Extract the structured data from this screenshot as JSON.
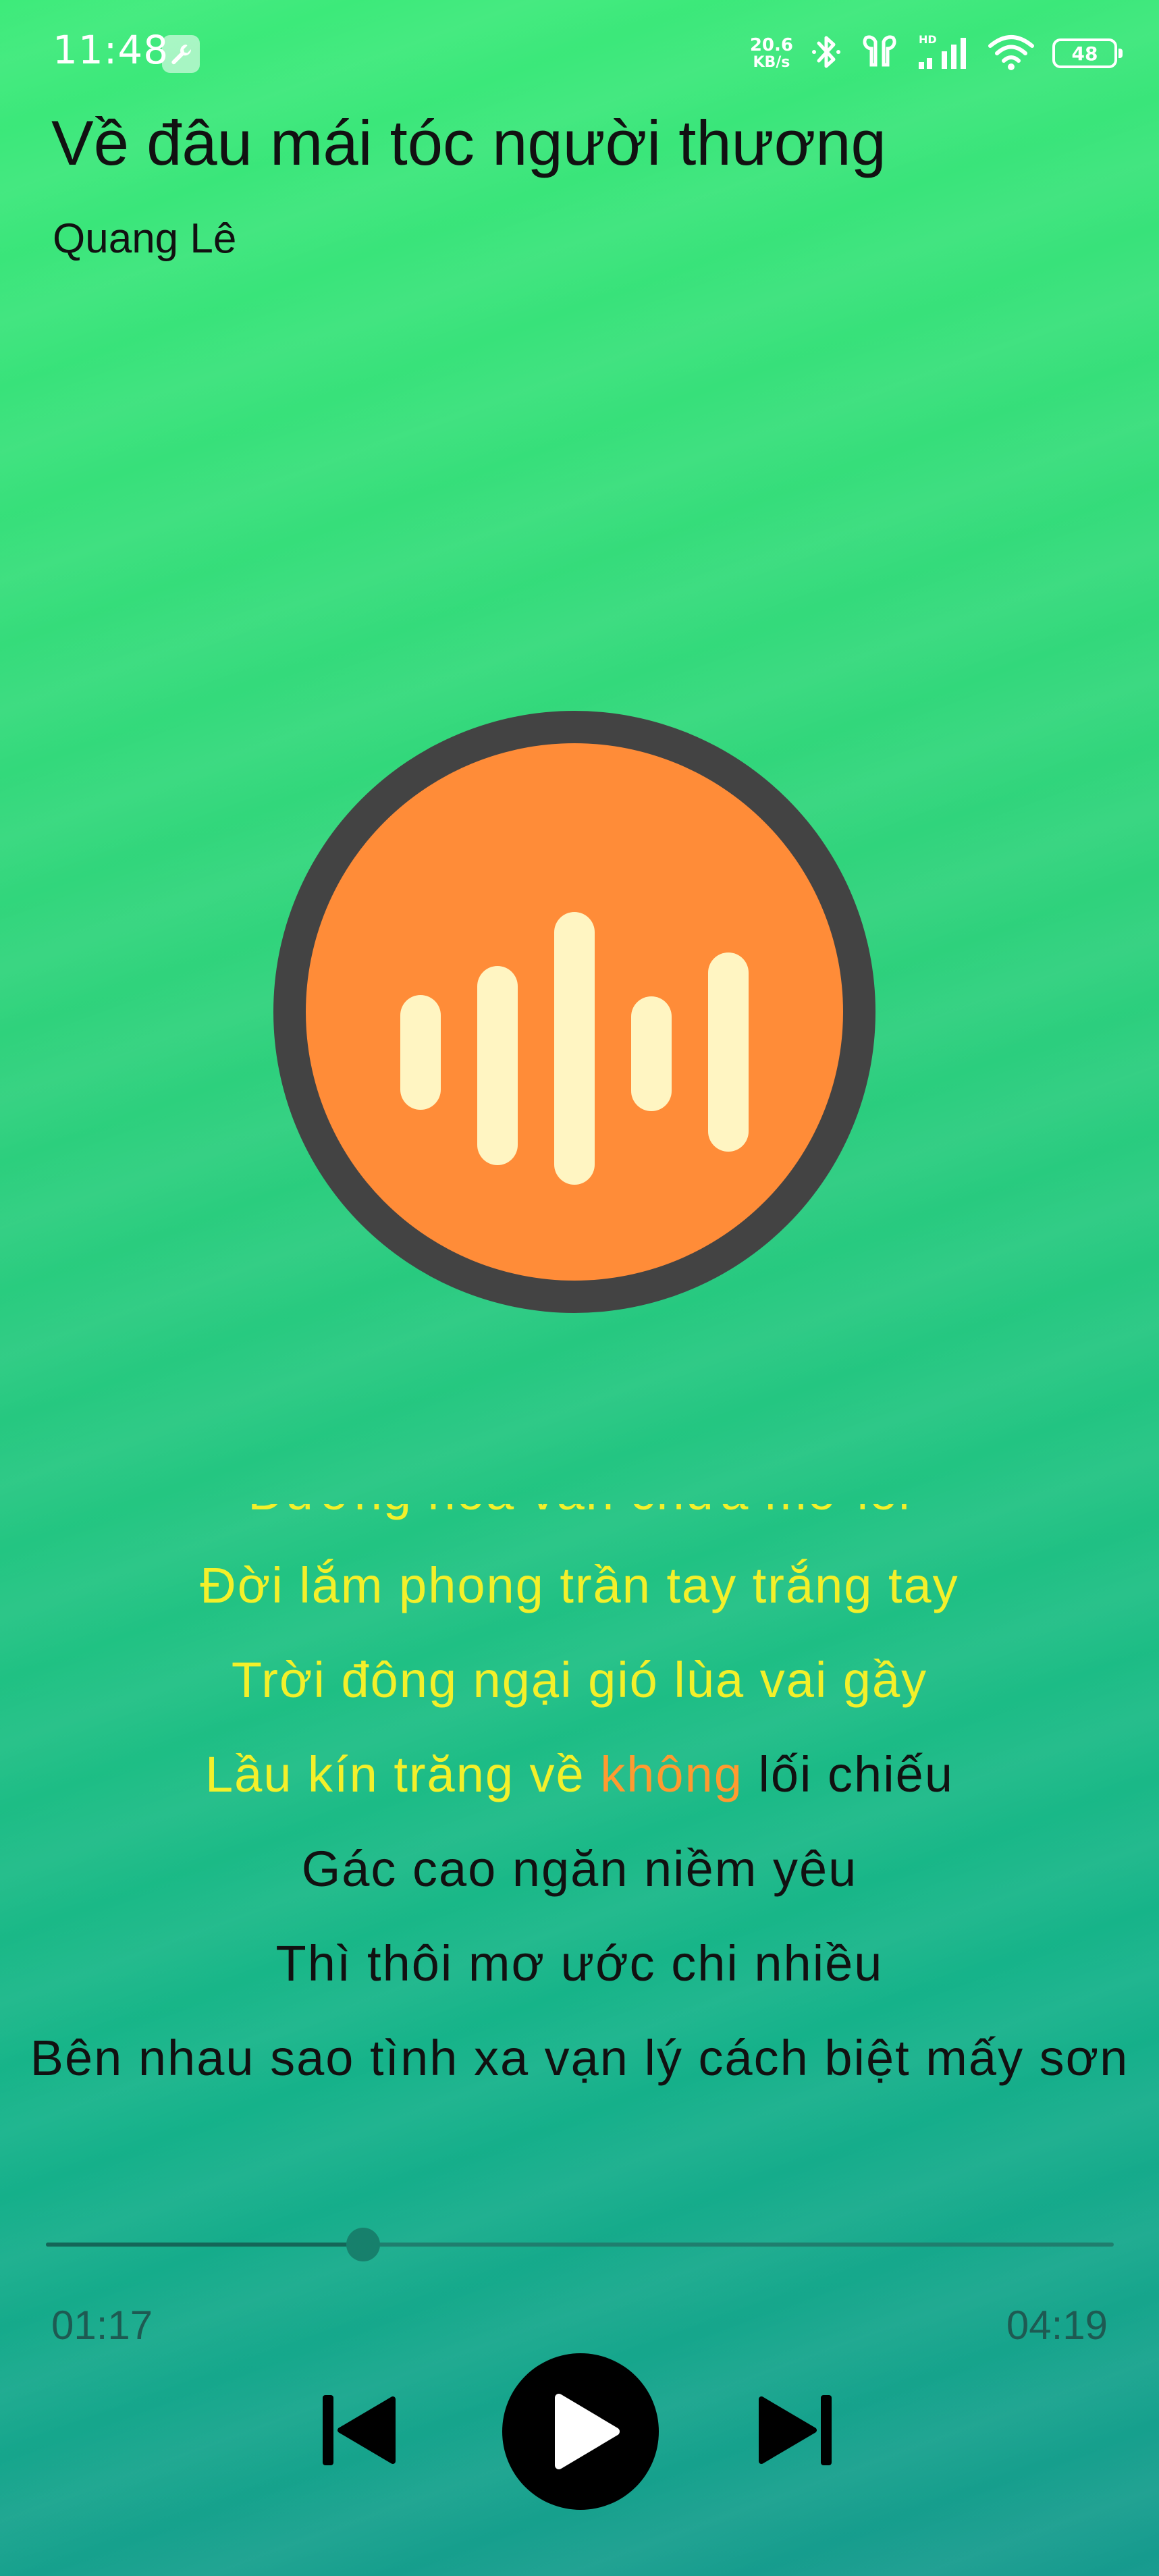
{
  "status_bar": {
    "time": "11:48",
    "net_speed_value": "20.6",
    "net_speed_unit": "KB/s",
    "battery_level": "48",
    "icons": [
      "wrench-icon",
      "bluetooth-icon",
      "earbuds-icon",
      "hd-signal-icon",
      "wifi-icon",
      "battery-icon"
    ]
  },
  "song": {
    "title": "Về đâu mái tóc người thương",
    "artist": "Quang Lê"
  },
  "album_art": {
    "icon": "audio-wave-icon",
    "ring_color": "#434343",
    "fill_color": "#ff8c38",
    "wave_color": "#fff5c2"
  },
  "lyrics": {
    "lines": [
      {
        "text": "Đường hoa vẫn chưa mở lối",
        "state": "sung"
      },
      {
        "text": "Đời lắm phong trần tay trắng tay",
        "state": "sung"
      },
      {
        "text": "Trời đông ngại gió lùa vai gầy",
        "state": "sung"
      },
      {
        "text": "Lầu kín trăng về không lối chiếu",
        "state": "current",
        "parts": {
          "before": "Lầu kín trăng về ",
          "highlight": "không",
          "after": " lối chiếu"
        }
      },
      {
        "text": "Gác cao ngăn niềm yêu",
        "state": "upcoming"
      },
      {
        "text": "Thì thôi mơ ước chi nhiều",
        "state": "upcoming"
      },
      {
        "text": "Bên nhau sao tình xa vạn lý cách biệt mấy sơn",
        "state": "upcoming"
      }
    ],
    "colors": {
      "sung": "#f3f02a",
      "current": "#ff9a30",
      "upcoming": "#111111"
    }
  },
  "player": {
    "elapsed": "01:17",
    "duration": "04:19",
    "progress_fraction": 0.297,
    "buttons": {
      "previous": "skip-previous-icon",
      "play": "play-icon",
      "next": "skip-next-icon"
    }
  },
  "theme": {
    "background_top": "#3deb7a",
    "background_bottom": "#169a8e"
  }
}
